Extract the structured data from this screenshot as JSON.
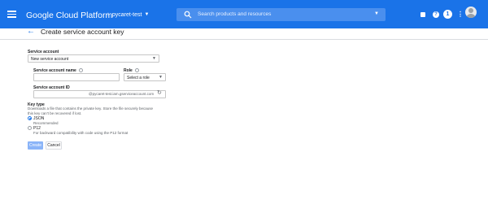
{
  "header": {
    "brand": "Google Cloud Platform",
    "project": "pycaret-test",
    "search_placeholder": "Search products and resources",
    "notifications_count": "1"
  },
  "page": {
    "title": "Create service account key"
  },
  "form": {
    "service_account": {
      "label": "Service account",
      "value": "New service account"
    },
    "service_account_name": {
      "label": "Service account name",
      "value": ""
    },
    "role": {
      "label": "Role",
      "value": "Select a role"
    },
    "service_account_id": {
      "label": "Service account ID",
      "suffix": "@pycaret-test.iam.gserviceaccount.com"
    },
    "key_type": {
      "label": "Key type",
      "description": "Downloads a file that contains the private key. Store the file securely because this key can't be recovered if lost.",
      "options": [
        {
          "label": "JSON",
          "sublabel": "Recommended",
          "checked": true
        },
        {
          "label": "P12",
          "sublabel": "For backward compatibility with code using the P12 format",
          "checked": false
        }
      ]
    },
    "buttons": {
      "create": "Create",
      "cancel": "Cancel"
    }
  },
  "colors": {
    "app_bar": "#1a73e8",
    "primary_button_disabled": "#8ab4f8"
  },
  "icons": {
    "menu": "menu-icon",
    "project": "project-dots-icon",
    "search": "search-icon",
    "back": "arrow-back-icon",
    "refresh": "refresh-icon",
    "help": "help-icon",
    "avatar": "avatar-icon"
  }
}
